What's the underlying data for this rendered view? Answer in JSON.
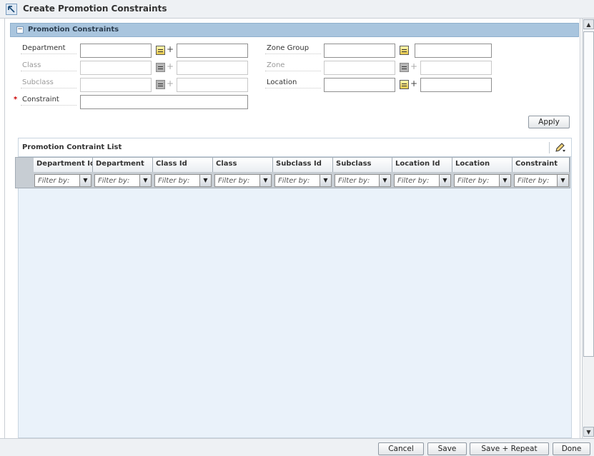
{
  "window": {
    "title": "Create Promotion Constraints"
  },
  "section": {
    "title": "Promotion Constraints",
    "fields": {
      "department_label": "Department",
      "class_label": "Class",
      "subclass_label": "Subclass",
      "constraint_label": "Constraint",
      "zone_group_label": "Zone Group",
      "zone_label": "Zone",
      "location_label": "Location",
      "required_marker": "*",
      "plus_symbol": "+"
    },
    "apply_label": "Apply"
  },
  "list": {
    "title": "Promotion Contraint List",
    "columns": [
      "Department Id",
      "Department",
      "Class Id",
      "Class",
      "Subclass Id",
      "Subclass",
      "Location Id",
      "Location",
      "Constraint"
    ],
    "filter_placeholder": "Filter by:"
  },
  "footer": {
    "cancel_label": "Cancel",
    "save_label": "Save",
    "save_repeat_label": "Save + Repeat",
    "done_label": "Done"
  },
  "icons": {
    "title": "arrow-up-left-icon",
    "collapse": "collapse-minus-icon",
    "lov": "list-of-values-icon",
    "edit": "pencil-edit-icon",
    "dropdown": "chevron-down-icon",
    "scroll_up": "scroll-up-icon",
    "scroll_down": "scroll-down-icon"
  },
  "colors": {
    "section_header": "#a9c5de",
    "panel_background": "#eaf2fa",
    "required": "#cc0000"
  }
}
